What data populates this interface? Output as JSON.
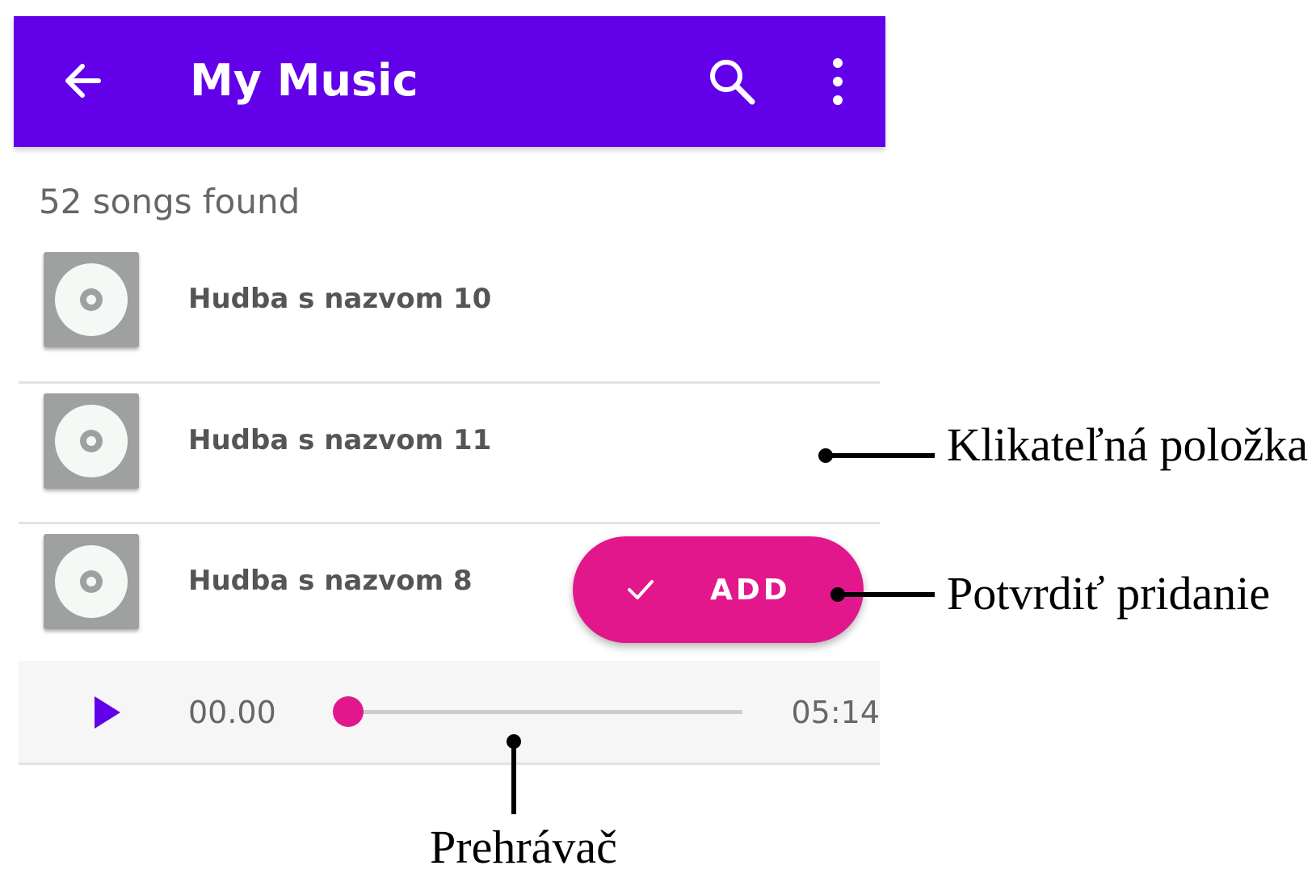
{
  "app_bar": {
    "title": "My Music",
    "background": "#6200EA",
    "icons": {
      "back": "arrow-back-icon",
      "search": "search-icon",
      "menu": "more-vert-icon"
    }
  },
  "song_count": "52 songs found",
  "songs": [
    {
      "title": "Hudba s nazvom 10",
      "icon": "disc-icon"
    },
    {
      "title": "Hudba s nazvom 11",
      "icon": "disc-icon"
    },
    {
      "title": "Hudba s nazvom 8",
      "icon": "disc-icon"
    }
  ],
  "fab": {
    "label": "ADD",
    "icon": "check-icon",
    "color": "#E3178C"
  },
  "player": {
    "current_time": "00.00",
    "total_time": "05:14",
    "progress": 0,
    "play_icon": "play-icon",
    "accent": "#E3178C"
  },
  "annotations": {
    "clickable_item": "Klikateľná položka",
    "confirm_add": "Potvrdiť pridanie",
    "player": "Prehrávač"
  }
}
